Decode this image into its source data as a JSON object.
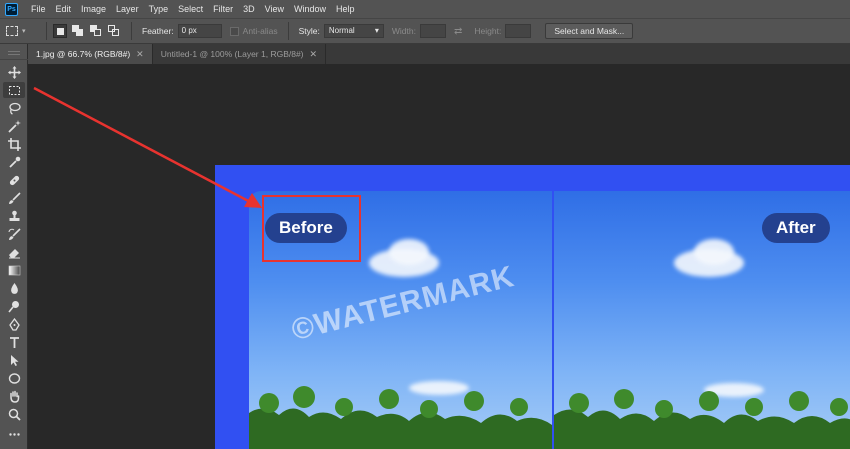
{
  "app": {
    "logo": "Ps"
  },
  "menu": [
    "File",
    "Edit",
    "Image",
    "Layer",
    "Type",
    "Select",
    "Filter",
    "3D",
    "View",
    "Window",
    "Help"
  ],
  "options": {
    "feather_label": "Feather:",
    "feather_value": "0 px",
    "antialias_label": "Anti-alias",
    "style_label": "Style:",
    "style_value": "Normal",
    "width_label": "Width:",
    "height_label": "Height:",
    "select_mask_label": "Select and Mask..."
  },
  "tabs": [
    {
      "label": "1.jpg @ 66.7% (RGB/8#)",
      "active": true
    },
    {
      "label": "Untitled-1 @ 100% (Layer 1, RGB/8#)",
      "active": false
    }
  ],
  "tools": [
    "move-icon",
    "rectangular-marquee-icon",
    "lasso-icon",
    "magic-wand-icon",
    "crop-icon",
    "eyedropper-icon",
    "healing-brush-icon",
    "brush-icon",
    "clone-stamp-icon",
    "history-brush-icon",
    "eraser-icon",
    "gradient-icon",
    "blur-icon",
    "dodge-icon",
    "pen-icon",
    "type-icon",
    "path-selection-icon",
    "ellipse-icon",
    "hand-icon",
    "zoom-icon",
    "more-tools-icon"
  ],
  "document": {
    "before_label": "Before",
    "after_label": "After",
    "watermark": "©WATERMARK"
  },
  "colors": {
    "annotation": "#e8332f",
    "doc_background": "#3150f2",
    "badge": "#24418f"
  }
}
